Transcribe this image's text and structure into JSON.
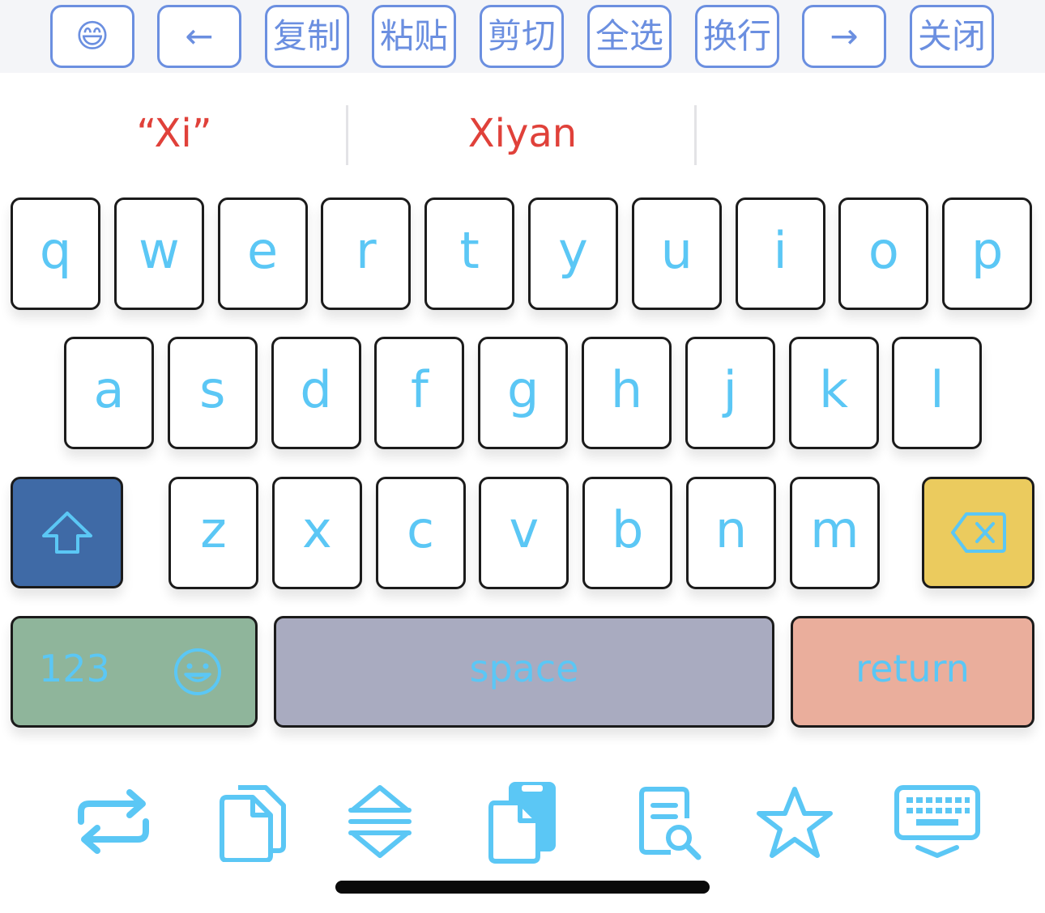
{
  "toolbar": {
    "emoji": "😄",
    "back_arrow": "←",
    "copy": "复制",
    "paste": "粘贴",
    "cut": "剪切",
    "select_all": "全选",
    "newline": "换行",
    "forward_arrow": "→",
    "close": "关闭"
  },
  "candidates": {
    "first": "“Xi”",
    "second": "Xiyan"
  },
  "keyboard": {
    "row1": [
      "q",
      "w",
      "e",
      "r",
      "t",
      "y",
      "u",
      "i",
      "o",
      "p"
    ],
    "row2": [
      "a",
      "s",
      "d",
      "f",
      "g",
      "h",
      "j",
      "k",
      "l"
    ],
    "row3": [
      "z",
      "x",
      "c",
      "v",
      "b",
      "n",
      "m"
    ],
    "numbers_label": "123",
    "space_label": "space",
    "return_label": "return"
  },
  "icons": {
    "shift": "shift-arrow-icon",
    "backspace": "backspace-icon",
    "emoji_face": "emoji-face-icon",
    "tools": [
      "switch-arrows-icon",
      "documents-icon",
      "expand-collapse-icon",
      "clipboard-icon",
      "document-search-icon",
      "star-icon",
      "keyboard-dismiss-icon"
    ]
  },
  "colors": {
    "accent_blue": "#6b8fe0",
    "key_text": "#5bc7f5",
    "candidate_red": "#e0413a",
    "shift_bg": "#3f6aa6",
    "backspace_bg": "#ebcb5e",
    "numbers_bg": "#8fb59b",
    "space_bg": "#a9abc0",
    "return_bg": "#eaae9c"
  }
}
